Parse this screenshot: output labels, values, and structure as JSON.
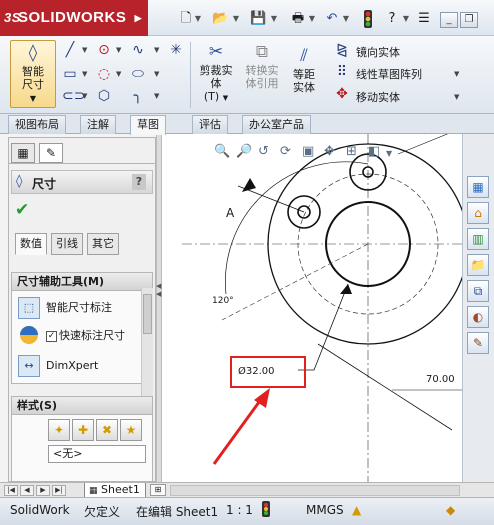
{
  "app": {
    "logo_text": "SOLIDWORKS",
    "logo_prefix": "3S",
    "quick_access": [
      "new-icon",
      "open-icon",
      "save-icon",
      "print-icon",
      "undo-icon",
      "rebuild-icon",
      "help-icon",
      "options-icon"
    ]
  },
  "ribbon": {
    "smart_dim_label": "智能尺寸",
    "trim_label": "剪裁实体",
    "trim_t": "(T)",
    "convert_label": "转换实体引用",
    "offset_label": "等距实体",
    "mirror_label": "镜向实体",
    "linear_pattern_label": "线性草图阵列",
    "move_label": "移动实体"
  },
  "tabs": [
    "视图布局",
    "注解",
    "草图",
    "评估",
    "办公室产品"
  ],
  "active_tab": "草图",
  "panel": {
    "title": "尺寸",
    "help": "?",
    "subtabs": [
      "数值",
      "引线",
      "其它"
    ],
    "tools_group": {
      "title": "尺寸辅助工具(M)",
      "smart_dim": "智能尺寸标注",
      "quick_dim": "快速标注尺寸",
      "dimxpert": "DimXpert"
    },
    "style_group": {
      "title": "样式(S)",
      "select_value": "<无>"
    }
  },
  "drawing": {
    "label_a": "A",
    "angle": "120°",
    "dimension": "Ø32.00",
    "length": "70.00"
  },
  "sheet": {
    "tab_label": "Sheet1"
  },
  "status": {
    "product": "SolidWork",
    "state": "欠定义",
    "editing": "在编辑 Sheet1",
    "scale": "1 : 1",
    "units": "MMGS",
    "colors": {
      "accent": "#b8232b",
      "highlight": "#e12020",
      "ok": "#1f9c2b"
    }
  }
}
